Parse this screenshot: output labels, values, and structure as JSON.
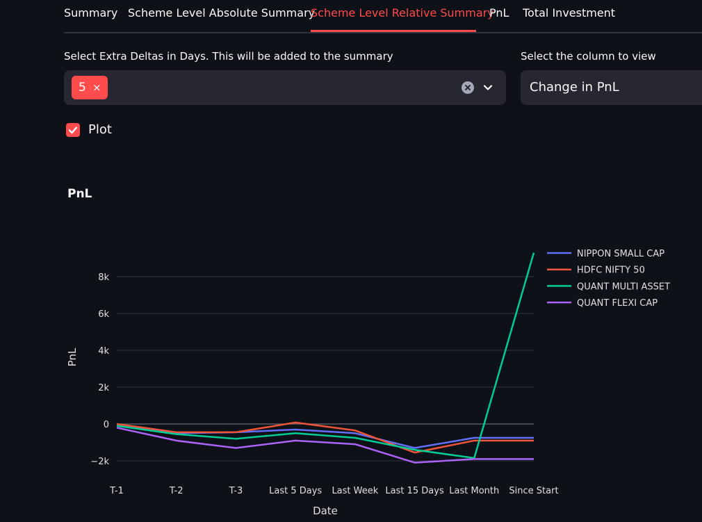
{
  "tabs": [
    {
      "label": "Summary",
      "active": false
    },
    {
      "label": "Scheme Level Absolute Summary",
      "active": false
    },
    {
      "label": "Scheme Level Relative Summary",
      "active": true
    },
    {
      "label": "PnL",
      "active": false
    },
    {
      "label": "Total Investment",
      "active": false
    }
  ],
  "deltas_select": {
    "label": "Select Extra Deltas in Days. This will be added to the summary",
    "chips": [
      {
        "value": "5",
        "remove_glyph": "×"
      }
    ]
  },
  "column_select": {
    "label": "Select the column to view",
    "value": "Change in PnL"
  },
  "plot_checkbox": {
    "label": "Plot",
    "checked": true
  },
  "colors": {
    "accent": "#ff4b4b",
    "background": "#0e1117",
    "widget": "#262730"
  },
  "icons": {
    "chip_remove": "close-icon",
    "clear": "clear-circle-icon",
    "dropdown": "chevron-down-icon",
    "checkbox": "check-icon"
  },
  "chart_data": {
    "type": "line",
    "title": "PnL",
    "xlabel": "Date",
    "ylabel": "PnL",
    "categories": [
      "T-1",
      "T-2",
      "T-3",
      "Last 5 Days",
      "Last Week",
      "Last 15 Days",
      "Last Month",
      "Since Start"
    ],
    "y_ticks": [
      -2000,
      0,
      2000,
      4000,
      6000,
      8000
    ],
    "y_tick_labels": [
      "−2k",
      "0",
      "2k",
      "4k",
      "6k",
      "8k"
    ],
    "ylim": [
      -2900,
      9600
    ],
    "grid": true,
    "legend_position": "top-right",
    "series": [
      {
        "name": "NIPPON SMALL CAP",
        "color": "#636efa",
        "values": [
          -100,
          -500,
          -450,
          -300,
          -500,
          -1300,
          -750,
          -750
        ]
      },
      {
        "name": "HDFC NIFTY 50",
        "color": "#ef553b",
        "values": [
          0,
          -450,
          -450,
          80,
          -350,
          -1550,
          -900,
          -900
        ]
      },
      {
        "name": "QUANT MULTI ASSET",
        "color": "#00cc96",
        "values": [
          -100,
          -550,
          -800,
          -500,
          -750,
          -1400,
          -1850,
          9300
        ]
      },
      {
        "name": "QUANT FLEXI CAP",
        "color": "#ab63fa",
        "values": [
          -200,
          -900,
          -1300,
          -900,
          -1100,
          -2100,
          -1900,
          -1900
        ]
      }
    ]
  }
}
